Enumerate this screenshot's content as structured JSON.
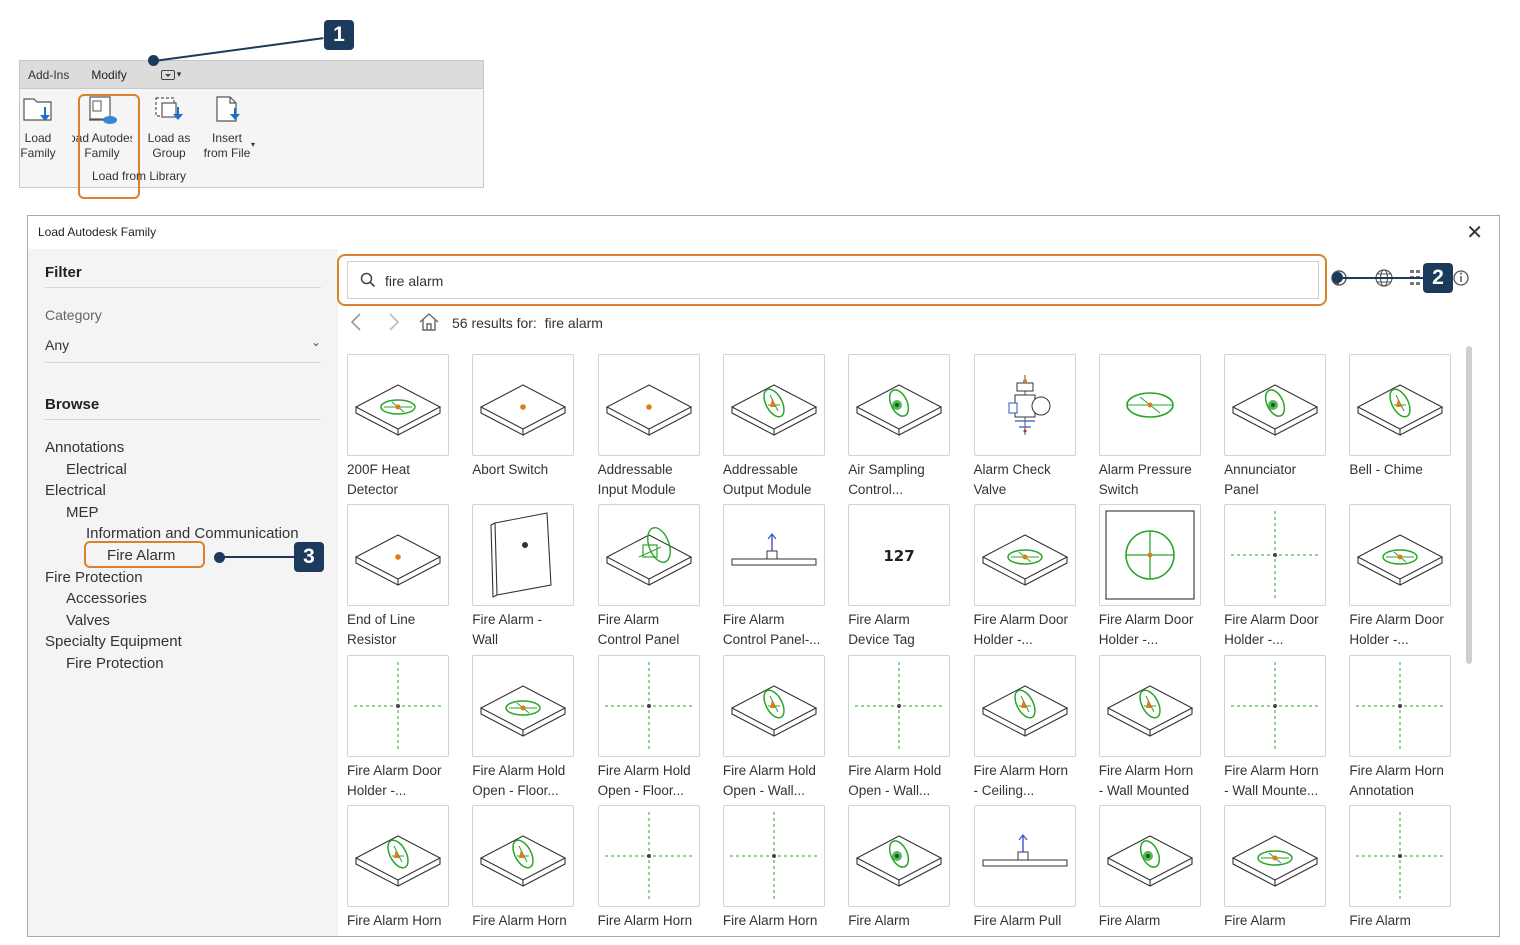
{
  "ribbon": {
    "tabs": [
      "Add-Ins",
      "Modify"
    ],
    "buttons": [
      {
        "line1": "Load",
        "line2": "Family"
      },
      {
        "line1": "Load Autodesk",
        "line2": "Family"
      },
      {
        "line1": "Load as",
        "line2": "Group"
      },
      {
        "line1": "Insert",
        "line2": "from File"
      }
    ],
    "group_label": "Load from Library"
  },
  "callouts": [
    "1",
    "2",
    "3"
  ],
  "dialog": {
    "title": "Load Autodesk Family",
    "close": "✕",
    "filter": {
      "title": "Filter",
      "category_label": "Category",
      "category_value": "Any"
    },
    "browse": {
      "title": "Browse",
      "tree": [
        {
          "label": "Annotations",
          "level": 1
        },
        {
          "label": "Electrical",
          "level": 2
        },
        {
          "label": "Electrical",
          "level": 1
        },
        {
          "label": "MEP",
          "level": 2
        },
        {
          "label": "Information and Communication",
          "level": 3
        },
        {
          "label": "Fire Alarm",
          "level": 4,
          "selected": true
        },
        {
          "label": "Fire Protection",
          "level": 1
        },
        {
          "label": "Accessories",
          "level": 2
        },
        {
          "label": "Valves",
          "level": 2
        },
        {
          "label": "Specialty Equipment",
          "level": 1
        },
        {
          "label": "Fire Protection",
          "level": 2
        }
      ]
    },
    "search": {
      "value": "fire alarm"
    },
    "results_text": "56 results for:  fire alarm",
    "items": [
      {
        "l1": "200F Heat",
        "l2": "Detector",
        "icon": "plate-ellipse"
      },
      {
        "l1": "Abort Switch",
        "l2": "",
        "icon": "plate-dot"
      },
      {
        "l1": "Addressable",
        "l2": "Input Module",
        "icon": "plate-dot"
      },
      {
        "l1": "Addressable",
        "l2": "Output Module",
        "icon": "plate-tilted"
      },
      {
        "l1": "Air Sampling",
        "l2": "Control...",
        "icon": "plate-dense"
      },
      {
        "l1": "Alarm Check",
        "l2": "Valve",
        "icon": "valve"
      },
      {
        "l1": "Alarm Pressure",
        "l2": "Switch",
        "icon": "ellipse-only"
      },
      {
        "l1": "Annunciator",
        "l2": "Panel",
        "icon": "plate-dense"
      },
      {
        "l1": "Bell - Chime",
        "l2": "",
        "icon": "plate-tilted"
      },
      {
        "l1": "End of Line",
        "l2": "Resistor",
        "icon": "plate-dot"
      },
      {
        "l1": "Fire Alarm -",
        "l2": "Wall",
        "icon": "wall-panel"
      },
      {
        "l1": "Fire Alarm",
        "l2": "Control Panel",
        "icon": "plate-box"
      },
      {
        "l1": "Fire Alarm",
        "l2": "Control Panel-...",
        "icon": "bar-pin"
      },
      {
        "l1": "Fire Alarm",
        "l2": "Device Tag",
        "icon": "tag-text"
      },
      {
        "l1": "Fire Alarm Door",
        "l2": "Holder -...",
        "icon": "plate-ellipse"
      },
      {
        "l1": "Fire Alarm Door",
        "l2": "Holder -...",
        "icon": "circle-frame"
      },
      {
        "l1": "Fire Alarm Door",
        "l2": "Holder -...",
        "icon": "crosshair"
      },
      {
        "l1": "Fire Alarm Door",
        "l2": "Holder -...",
        "icon": "plate-ellipse"
      },
      {
        "l1": "Fire Alarm Door",
        "l2": "Holder -...",
        "icon": "crosshair"
      },
      {
        "l1": "Fire Alarm Hold",
        "l2": "Open - Floor...",
        "icon": "plate-ellipse"
      },
      {
        "l1": "Fire Alarm Hold",
        "l2": "Open - Floor...",
        "icon": "crosshair"
      },
      {
        "l1": "Fire Alarm Hold",
        "l2": "Open - Wall...",
        "icon": "plate-tilted"
      },
      {
        "l1": "Fire Alarm Hold",
        "l2": "Open - Wall...",
        "icon": "crosshair"
      },
      {
        "l1": "Fire Alarm Horn",
        "l2": "- Ceiling...",
        "icon": "plate-tilted"
      },
      {
        "l1": "Fire Alarm Horn",
        "l2": "- Wall Mounted",
        "icon": "plate-tilted"
      },
      {
        "l1": "Fire Alarm Horn",
        "l2": "- Wall Mounte...",
        "icon": "crosshair"
      },
      {
        "l1": "Fire Alarm Horn",
        "l2": "Annotation",
        "icon": "crosshair"
      },
      {
        "l1": "Fire Alarm Horn",
        "l2": "",
        "icon": "plate-tilted"
      },
      {
        "l1": "Fire Alarm Horn",
        "l2": "",
        "icon": "plate-tilted"
      },
      {
        "l1": "Fire Alarm Horn",
        "l2": "",
        "icon": "crosshair"
      },
      {
        "l1": "Fire Alarm Horn",
        "l2": "",
        "icon": "crosshair"
      },
      {
        "l1": "Fire Alarm",
        "l2": "",
        "icon": "plate-dense"
      },
      {
        "l1": "Fire Alarm Pull",
        "l2": "",
        "icon": "bar-pin"
      },
      {
        "l1": "Fire Alarm",
        "l2": "",
        "icon": "plate-dense"
      },
      {
        "l1": "Fire Alarm",
        "l2": "",
        "icon": "plate-ellipse"
      },
      {
        "l1": "Fire Alarm",
        "l2": "",
        "icon": "crosshair"
      }
    ],
    "tag_text": "127"
  },
  "colors": {
    "highlight": "#d9822b",
    "callout": "#1b3a5c",
    "symbol_green": "#2aa52a",
    "symbol_orange": "#e07b1a"
  }
}
